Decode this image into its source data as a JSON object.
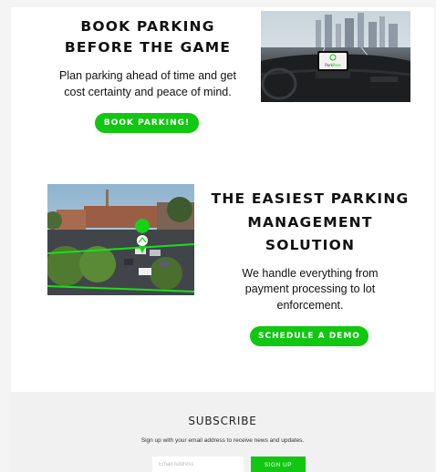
{
  "section_book": {
    "title_line1": "BOOK PARKING",
    "title_line2": "BEFORE THE GAME",
    "body_line1": "Plan parking ahead of time and get",
    "body_line2": "cost certainty and peace of mind.",
    "button_label": "BOOK PARKING!"
  },
  "section_management": {
    "title_line1": "THE EASIEST PARKING",
    "title_line2": "MANAGEMENT",
    "title_line3": "SOLUTION",
    "body_line1": "We handle everything from",
    "body_line2": "payment processing to lot",
    "body_line3": "enforcement.",
    "button_label": "SCHEDULE A DEMO"
  },
  "subscribe": {
    "title": "SUBSCRIBE",
    "description": "Sign up with your email address to receive news and updates.",
    "email_placeholder": "Email Address",
    "button_label": "SIGN UP"
  },
  "car_image": {
    "logo_text_1": "Park",
    "logo_text_2": "Pass"
  },
  "colors": {
    "accent": "#11c711",
    "page_bg": "#ffffff",
    "footer_bg": "#f1f1f1"
  }
}
